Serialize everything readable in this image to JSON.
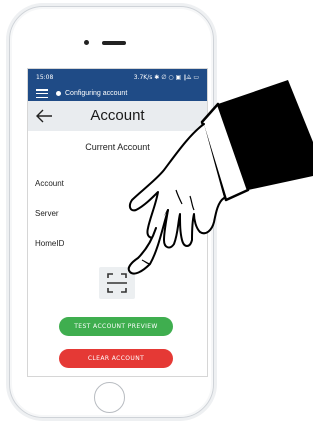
{
  "statusbar": {
    "time": "15:08",
    "indicators": "3.7K/s ✱ ∅ ○ ▣ ∥⨻ ▭"
  },
  "notification": {
    "text": "Configuring account"
  },
  "appbar": {
    "title": "Account"
  },
  "content": {
    "section_title": "Current Account",
    "fields": [
      {
        "label": "Account"
      },
      {
        "label": "Server"
      },
      {
        "label": "HomeID"
      }
    ]
  },
  "buttons": {
    "test_preview": "TEST ACCOUNT PREVIEW",
    "clear": "CLEAR ACCOUNT"
  },
  "colors": {
    "status_bar": "#1f4b86",
    "app_bar": "#e9ecef",
    "test_button": "#3fae4f",
    "clear_button": "#e53935"
  },
  "icons": [
    "menu-icon",
    "back-arrow-icon",
    "qr-scan-icon",
    "pointing-hand-icon"
  ]
}
